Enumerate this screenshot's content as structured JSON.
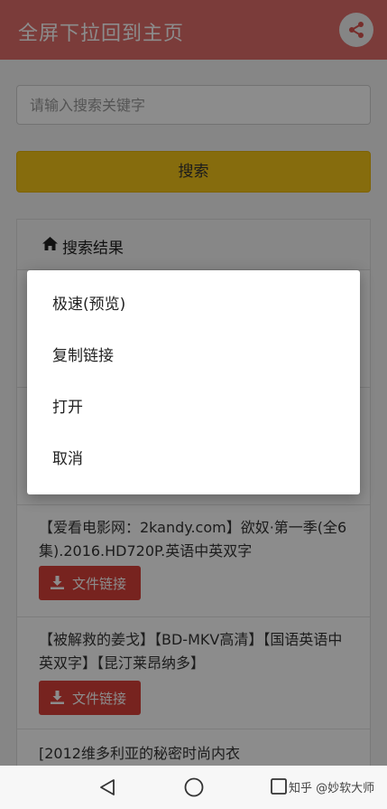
{
  "header": {
    "title": "全屏下拉回到主页",
    "share_icon": "share-icon",
    "color": "#e06d6a"
  },
  "search": {
    "placeholder": "请输入搜索关键字",
    "button_label": "搜索",
    "button_color": "#f5c518"
  },
  "results": {
    "header_icon": "home-icon",
    "header_label": "搜索结果",
    "items": [
      {
        "title": "【爱看电影网：2kandy.com】欲奴·第一季(全6集).2016.HD720P.英语中英双字",
        "button_label": "文件链接"
      },
      {
        "title": "【被解救的姜戈】【BD-MKV高清】【国语英语中英双字】【昆汀莱昂纳多】",
        "button_label": "文件链接"
      },
      {
        "title": "[2012维多利亚的秘密时尚内衣"
      }
    ],
    "button_color": "#d9413a"
  },
  "dialog": {
    "items": [
      {
        "label": "极速(预览)"
      },
      {
        "label": "复制链接"
      },
      {
        "label": "打开"
      },
      {
        "label": "取消"
      }
    ]
  },
  "navbar": {
    "back_icon": "back-triangle-icon",
    "home_icon": "home-circle-icon",
    "recent_icon": "recent-square-icon",
    "watermark": "知乎 @妙软大师"
  }
}
